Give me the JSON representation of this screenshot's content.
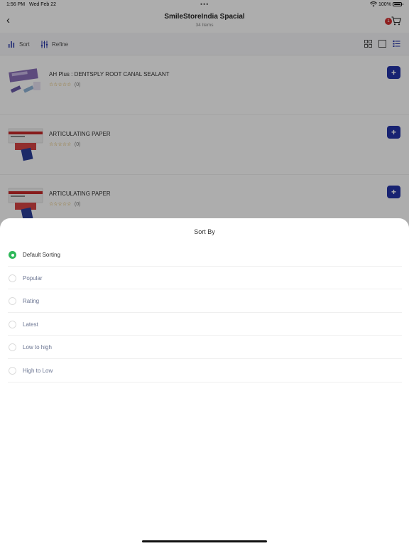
{
  "status_bar": {
    "time": "1:56 PM",
    "date": "Wed Feb 22",
    "battery": "100%"
  },
  "header": {
    "title": "SmileStoreIndia Spacial",
    "subtitle": "34 Items",
    "cart_badge": "1"
  },
  "toolbar": {
    "sort_label": "Sort",
    "refine_label": "Refine"
  },
  "products": [
    {
      "name": "AH Plus : DENTSPLY ROOT CANAL SEALANT",
      "rating": "☆☆☆☆☆",
      "reviews": "(0)",
      "add_label": "+"
    },
    {
      "name": "ARTICULATING PAPER",
      "rating": "☆☆☆☆☆",
      "reviews": "(0)",
      "add_label": "+"
    },
    {
      "name": "ARTICULATING PAPER",
      "rating": "☆☆☆☆☆",
      "reviews": "(0)",
      "add_label": "+"
    }
  ],
  "sort_sheet": {
    "title": "Sort By",
    "options": [
      {
        "label": "Default Sorting",
        "selected": true
      },
      {
        "label": "Popular",
        "selected": false
      },
      {
        "label": "Rating",
        "selected": false
      },
      {
        "label": "Latest",
        "selected": false
      },
      {
        "label": "Low to high",
        "selected": false
      },
      {
        "label": "High to Low",
        "selected": false
      }
    ]
  },
  "colors": {
    "accent": "#2434a8",
    "selected_radio": "#2fb85a",
    "badge": "#d32f2f",
    "star": "#d49a1c"
  }
}
